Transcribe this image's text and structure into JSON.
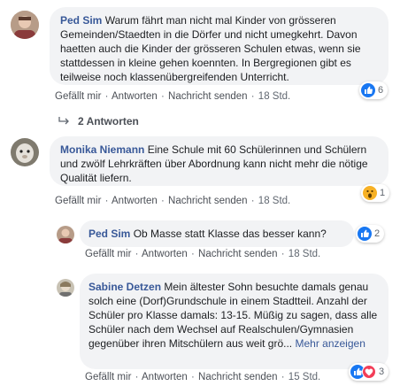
{
  "colors": {
    "author": "#385898",
    "bubble": "#f2f3f5",
    "like_blue": "#1877f2",
    "love_red": "#f33e58",
    "wow_yellow": "#f7b125"
  },
  "comments": [
    {
      "author": "Ped Sim",
      "text": "Warum fährt man nicht mal Kinder von grösseren Gemeinden/Staedten in die Dörfer und nicht umegkehrt. Davon haetten auch die Kinder der grösseren Schulen etwas, wenn sie stattdessen in kleine gehen koennten. In Bergregionen gibt es teilweise noch klassenübergreifenden Unterricht.",
      "like": "Gefällt mir",
      "reply": "Antworten",
      "send": "Nachricht senden",
      "time": "18 Std.",
      "reaction_icons": [
        "like-icon"
      ],
      "reaction_count": "6"
    },
    {
      "author": "Monika Niemann",
      "text": "Eine Schule mit 60 Schülerinnen und Schülern und zwölf Lehrkräften über Abordnung kann nicht mehr die nötige Qualität liefern.",
      "like": "Gefällt mir",
      "reply": "Antworten",
      "send": "Nachricht senden",
      "time": "18 Std.",
      "reaction_icons": [
        "wow-icon"
      ],
      "reaction_count": "1"
    }
  ],
  "replies_toggle": {
    "label": "2 Antworten",
    "icon": "reply-arrow-icon"
  },
  "replies": [
    {
      "author": "Ped Sim",
      "text": "Ob Masse statt Klasse das besser kann?",
      "like": "Gefällt mir",
      "reply": "Antworten",
      "send": "Nachricht senden",
      "time": "18 Std.",
      "reaction_icons": [
        "like-icon"
      ],
      "reaction_count": "2"
    },
    {
      "author": "Sabine Detzen",
      "text": "Mein ältester Sohn besuchte damals genau solch eine (Dorf)Grundschule in einem Stadtteil. Anzahl der Schüler pro Klasse damals: 13-15. Müßig zu sagen, dass alle Schüler nach dem Wechsel auf Realschulen/Gymnasien gegenüber ihren Mitschülern aus weit grö...",
      "more": "Mehr anzeigen",
      "like": "Gefällt mir",
      "reply": "Antworten",
      "send": "Nachricht senden",
      "time": "15 Std.",
      "reaction_icons": [
        "like-icon",
        "love-icon"
      ],
      "reaction_count": "3"
    }
  ]
}
